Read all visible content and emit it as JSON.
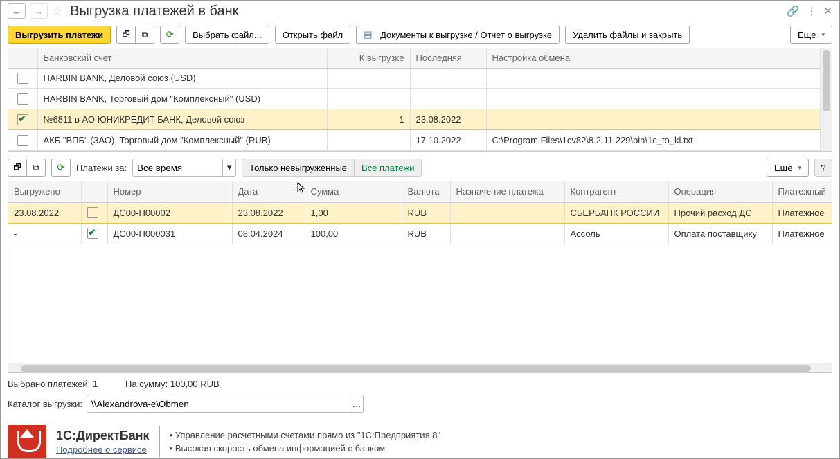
{
  "header": {
    "title": "Выгрузка платежей в банк"
  },
  "toolbar": {
    "export_label": "Выгрузить платежи",
    "select_file_label": "Выбрать файл...",
    "open_file_label": "Открыть файл",
    "documents_report_label": "Документы к выгрузке / Отчет о выгрузке",
    "delete_close_label": "Удалить файлы и закрыть",
    "more_label": "Еще"
  },
  "accounts_grid": {
    "headers": {
      "account": "Банковский счет",
      "to_export": "К выгрузке",
      "last": "Последняя",
      "settings": "Настройка обмена"
    },
    "rows": [
      {
        "checked": false,
        "account": "HARBIN BANK, Деловой союз (USD)",
        "to_export": "",
        "last": "",
        "settings": ""
      },
      {
        "checked": false,
        "account": "HARBIN BANK, Торговый дом \"Комплексный\" (USD)",
        "to_export": "",
        "last": "",
        "settings": ""
      },
      {
        "checked": true,
        "account": "№6811 в АО ЮНИКРЕДИТ БАНК, Деловой союз",
        "to_export": "1",
        "last": "23.08.2022",
        "settings": "",
        "selected": true
      },
      {
        "checked": false,
        "account": "АКБ \"ВПБ\" (ЗАО), Торговый дом \"Комплексный\" (RUB)",
        "to_export": "",
        "last": "17.10.2022",
        "settings": "C:\\Program Files\\1cv82\\8.2.11.229\\bin\\1c_to_kl.txt"
      }
    ]
  },
  "toolbar2": {
    "payments_for_label": "Платежи за:",
    "period_value": "Все время",
    "only_not_exported_label": "Только невыгруженные",
    "all_payments_label": "Все платежи",
    "more_label": "Еще"
  },
  "payments_grid": {
    "headers": {
      "exported": "Выгружено",
      "chk": "",
      "number": "Номер",
      "date": "Дата",
      "sum": "Сумма",
      "currency": "Валюта",
      "purpose": "Назначение платежа",
      "counterparty": "Контрагент",
      "operation": "Операция",
      "order": "Платежный"
    },
    "rows": [
      {
        "selected": true,
        "exported": "23.08.2022",
        "checked": false,
        "number": "ДС00-П00002",
        "date": "23.08.2022",
        "sum": "1,00",
        "currency": "RUB",
        "purpose": "",
        "counterparty": "СБЕРБАНК РОССИИ",
        "operation": "Прочий расход ДС",
        "order": "Платежное"
      },
      {
        "selected": false,
        "exported": "-",
        "checked": true,
        "number": "ДС00-П000031",
        "date": "08.04.2024",
        "sum": "100,00",
        "currency": "RUB",
        "purpose": "",
        "counterparty": "Ассоль",
        "operation": "Оплата поставщику",
        "order": "Платежное"
      }
    ]
  },
  "footer": {
    "selected_label": "Выбрано платежей:  1",
    "sum_label": "На сумму: 100,00 RUB",
    "dir_label": "Каталог выгрузки:",
    "dir_value": "\\\\Alexandrova-e\\Obmen"
  },
  "banner": {
    "title": "1С:ДиректБанк",
    "link": "Подробнее о сервисе",
    "bullet1": "• Управление расчетными счетами прямо из \"1С:Предприятия 8\"",
    "bullet2": "• Высокая скорость обмена информацией с банком"
  }
}
